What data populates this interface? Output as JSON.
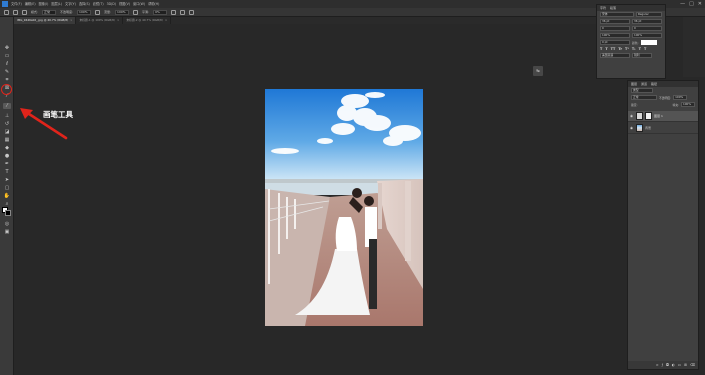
{
  "app": {
    "menu": [
      "文件(F)",
      "编辑(E)",
      "图像(I)",
      "图层(L)",
      "文字(Y)",
      "选择(S)",
      "滤镜(T)",
      "3D(D)",
      "视图(V)",
      "窗口(W)",
      "帮助(H)"
    ],
    "window_controls": [
      "—",
      "□",
      "✕"
    ]
  },
  "options_bar": {
    "mode_label": "模式:",
    "mode_value": "正常",
    "opacity_label": "不透明度:",
    "opacity_value": "100%",
    "flow_label": "流量:",
    "flow_value": "100%",
    "smooth_label": "平滑:",
    "smooth_value": "0%"
  },
  "tabs": [
    {
      "label": "IMG_9446a02_.jpg @ 40.7% (RGB/8)",
      "active": true
    },
    {
      "label": "未标题-1 @ 100% (RGB/8)",
      "active": false
    },
    {
      "label": "未标题-2 @ 40.7% (RGB/8)",
      "active": false
    }
  ],
  "annotation": {
    "label": "画笔工具",
    "arrow_color": "#e0241b"
  },
  "character_panel": {
    "tabs": [
      "字符",
      "段落"
    ],
    "font_family": "宋体",
    "font_style": "Regular",
    "font_size": "36 pt",
    "leading": "36 pt",
    "kerning": "0",
    "tracking": "0",
    "vscale": "100%",
    "hscale": "100%",
    "baseline": "0 pt",
    "color_label": "颜色:",
    "styles": [
      "T",
      "T",
      "TT",
      "Tr",
      "T¹",
      "T₁",
      "T",
      "T"
    ],
    "lang": "美国英语",
    "aa": "锐利"
  },
  "layers_panel": {
    "tabs": [
      "图层",
      "通道",
      "路径"
    ],
    "kind_label": "类型",
    "blend_mode": "正常",
    "opacity_label": "不透明度:",
    "opacity_value": "100%",
    "lock_label": "锁定:",
    "fill_label": "填充:",
    "fill_value": "100%",
    "layers": [
      {
        "name": "图层 1",
        "active": true
      },
      {
        "name": "背景",
        "active": false
      }
    ],
    "footer_icons": [
      "link-icon",
      "fx-icon",
      "mask-icon",
      "adjust-icon",
      "folder-icon",
      "new-layer-icon",
      "trash-icon"
    ]
  },
  "colors": {
    "foreground": "#ffffff",
    "background": "#000000",
    "brand": "#2f7bd1"
  }
}
